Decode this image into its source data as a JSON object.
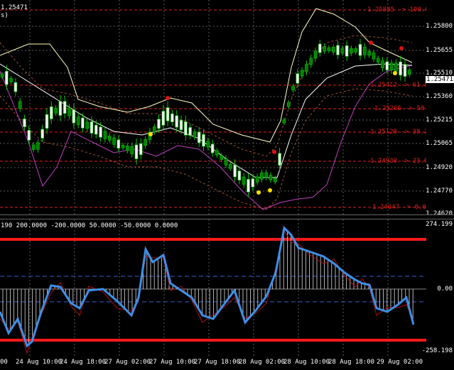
{
  "main": {
    "corner_price": "1.25471",
    "corner_sub": "s)",
    "scale": [
      "1.25800",
      "1.25655",
      "1.25510",
      "1.25360",
      "1.25215",
      "1.25065",
      "1.24920",
      "1.24770",
      "1.24620"
    ],
    "current_price": "1.25471",
    "fib_levels": [
      {
        "price": "1.25885",
        "pct": "100.0%"
      },
      {
        "price": "1.25412",
        "pct": "61.8%"
      },
      {
        "price": "1.25266",
        "pct": "50.0%"
      },
      {
        "price": "1.25120",
        "pct": "38.2%"
      },
      {
        "price": "1.24939",
        "pct": "23.6%"
      },
      {
        "price": "1.24647",
        "pct": "0.0%"
      }
    ]
  },
  "sub": {
    "header": "190 200.0000 -200.0000 50.0000 -50.0000 0.0000",
    "scale_top": "274.199",
    "scale_zero": "0.00",
    "scale_bottom": "-258.198"
  },
  "time_labels": [
    "00",
    "24 Aug 10:00",
    "24 Aug 18:00",
    "27 Aug 02:00",
    "27 Aug 10:00",
    "27 Aug 18:00",
    "28 Aug 02:00",
    "28 Aug 10:00",
    "28 Aug 18:00",
    "29 Aug 02:00"
  ],
  "colors": {
    "bull_candle": "#f0f0f0",
    "bear_candle": "#008000",
    "wick": "#00c800",
    "upper_band": "#ffffc0",
    "lower_band": "#c040c0",
    "fib": "#e0201c",
    "cci": "#3d8fe8",
    "cci_signal": "#b01010",
    "level_line": "#ff1a1a",
    "grid": "#5a5a5a"
  }
}
